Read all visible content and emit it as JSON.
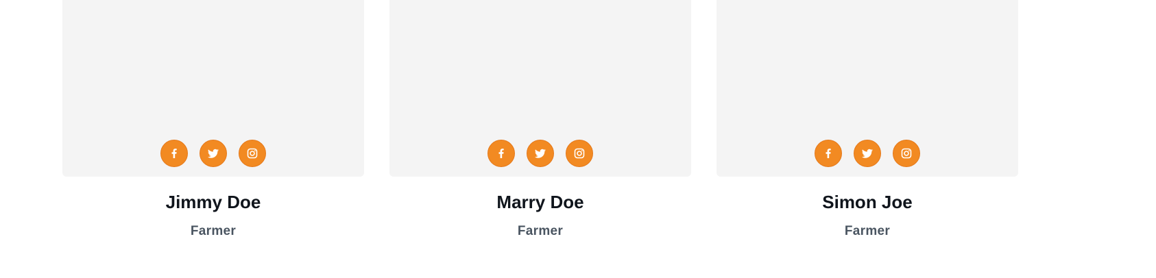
{
  "theme": {
    "accent": "#f28a22",
    "card_bg": "#f4f4f4",
    "name_color": "#10151c",
    "role_color": "#4a5561"
  },
  "team": [
    {
      "name": "Jimmy Doe",
      "role": "Farmer",
      "social": [
        {
          "icon": "facebook-icon"
        },
        {
          "icon": "twitter-icon"
        },
        {
          "icon": "instagram-icon"
        }
      ]
    },
    {
      "name": "Marry Doe",
      "role": "Farmer",
      "social": [
        {
          "icon": "facebook-icon"
        },
        {
          "icon": "twitter-icon"
        },
        {
          "icon": "instagram-icon"
        }
      ]
    },
    {
      "name": "Simon Joe",
      "role": "Farmer",
      "social": [
        {
          "icon": "facebook-icon"
        },
        {
          "icon": "twitter-icon"
        },
        {
          "icon": "instagram-icon"
        }
      ]
    }
  ]
}
